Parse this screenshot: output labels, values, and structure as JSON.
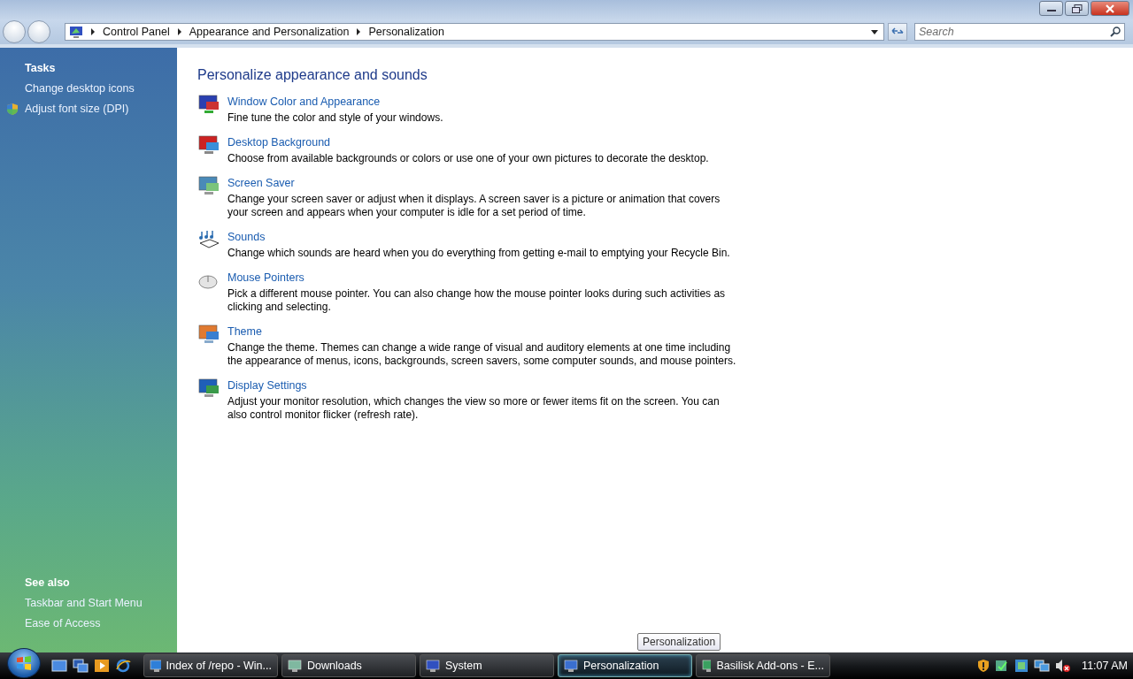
{
  "address_bar": {
    "breadcrumbs": [
      "Control Panel",
      "Appearance and Personalization",
      "Personalization"
    ]
  },
  "search": {
    "placeholder": "Search"
  },
  "sidebar": {
    "tasks_heading": "Tasks",
    "tasks": [
      {
        "label": "Change desktop icons",
        "shield": false
      },
      {
        "label": "Adjust font size (DPI)",
        "shield": true
      }
    ],
    "see_also_heading": "See also",
    "see_also": [
      "Taskbar and Start Menu",
      "Ease of Access"
    ]
  },
  "content": {
    "title": "Personalize appearance and sounds",
    "items": [
      {
        "kind": "window",
        "title": "Window Color and Appearance",
        "description": "Fine tune the color and style of your windows."
      },
      {
        "kind": "background",
        "title": "Desktop Background",
        "description": "Choose from available backgrounds or colors or use one of your own pictures to decorate the desktop."
      },
      {
        "kind": "screensaver",
        "title": "Screen Saver",
        "description": "Change your screen saver or adjust when it displays. A screen saver is a picture or animation that covers your screen and appears when your computer is idle for a set period of time."
      },
      {
        "kind": "sounds",
        "title": "Sounds",
        "description": "Change which sounds are heard when you do everything from getting e-mail to emptying your Recycle Bin."
      },
      {
        "kind": "mouse",
        "title": "Mouse Pointers",
        "description": "Pick a different mouse pointer. You can also change how the mouse pointer looks during such activities as clicking and selecting."
      },
      {
        "kind": "theme",
        "title": "Theme",
        "description": "Change the theme. Themes can change a wide range of visual and auditory elements at one time including the appearance of menus, icons, backgrounds, screen savers, some computer sounds, and mouse pointers."
      },
      {
        "kind": "display",
        "title": "Display Settings",
        "description": "Adjust your monitor resolution, which changes the view so more or fewer items fit on the screen. You can also control monitor flicker (refresh rate)."
      }
    ]
  },
  "taskbar": {
    "buttons": [
      {
        "kind": "browser",
        "label": "Index of /repo - Win...",
        "selected": false
      },
      {
        "kind": "folder",
        "label": "Downloads",
        "selected": false
      },
      {
        "kind": "system",
        "label": "System",
        "selected": false
      },
      {
        "kind": "display",
        "label": "Personalization",
        "selected": true
      },
      {
        "kind": "basilisk",
        "label": "Basilisk Add-ons - E...",
        "selected": false
      }
    ],
    "tooltip": "Personalization",
    "clock": "11:07 AM"
  }
}
